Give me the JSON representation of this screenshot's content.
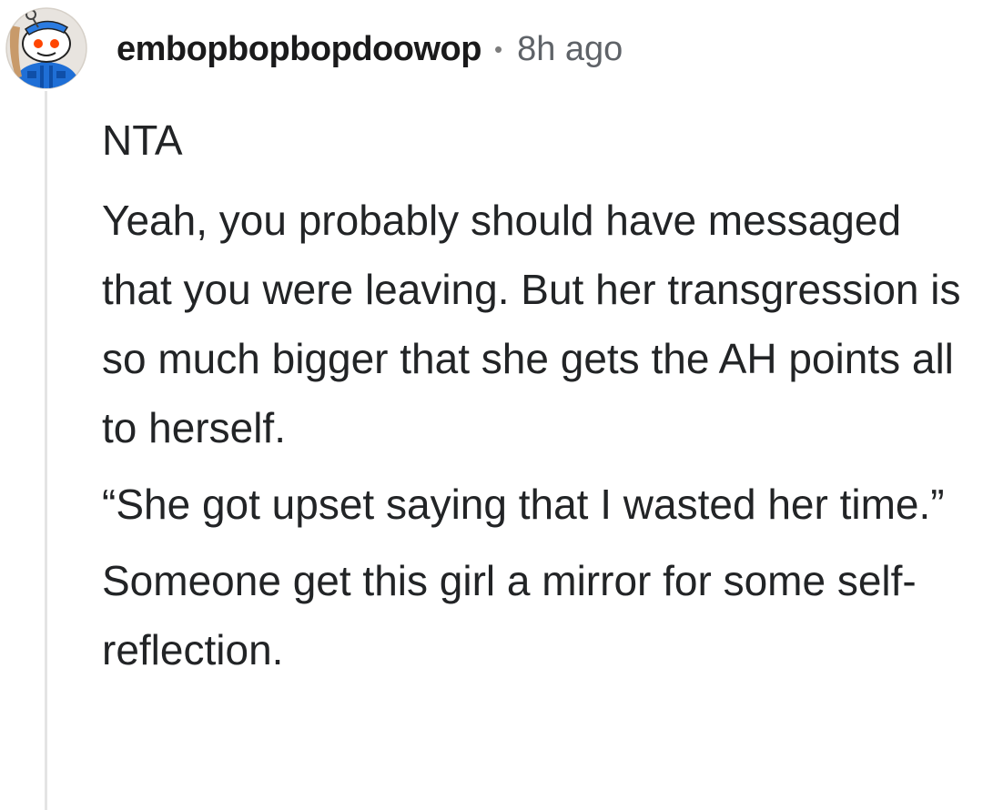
{
  "comment": {
    "author": "embopbopbopdoowop",
    "separator": "•",
    "timestamp": "8h ago",
    "avatar_icon": "snoo-avatar-icon",
    "paragraphs": [
      "NTA",
      "Yeah, you probably should have messaged that you were leaving. But her transgression is so much bigger that she gets the AH points all to herself.",
      "“She got upset saying that I wasted her time.”",
      "Someone get this girl a mirror for some self-reflection."
    ]
  },
  "colors": {
    "username": "#1a1a1b",
    "timestamp": "#5f6368",
    "body_text": "#222426",
    "thread_line": "#e4e4e4",
    "avatar_bg": "#e8e4df",
    "avatar_shirt": "#1f6fd6"
  }
}
